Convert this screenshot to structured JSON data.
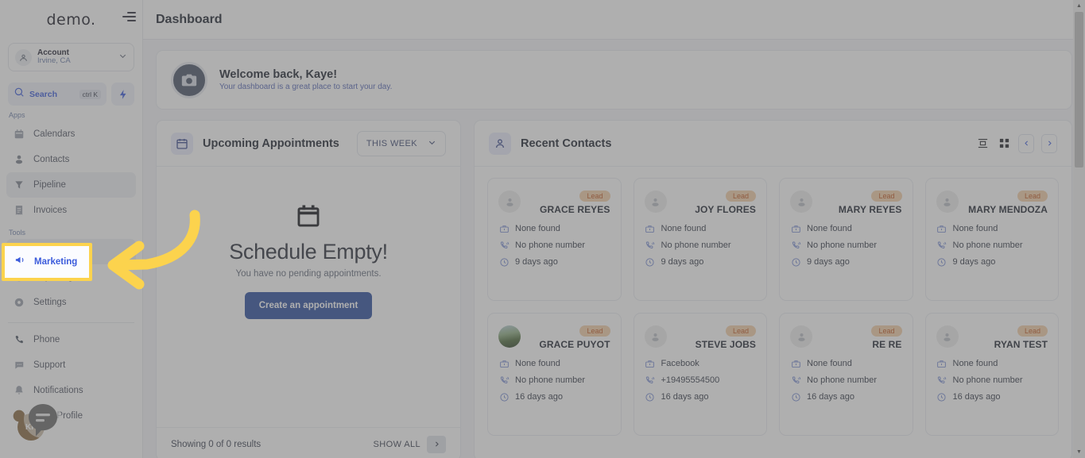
{
  "sidebar": {
    "brand": "demo.",
    "collapse_icon": "collapse-sidebar-icon",
    "account": {
      "name": "Account",
      "location": "Irvine, CA",
      "avatar_icon": "user-circle-icon",
      "chevron_icon": "chevron-down-icon"
    },
    "search": {
      "label": "Search",
      "shortcut": "ctrl K",
      "icon": "search-icon",
      "bolt_icon": "lightning-bolt-icon"
    },
    "groups": [
      {
        "label": "Apps",
        "items": [
          {
            "label": "Calendars",
            "icon": "calendar-icon",
            "active": false
          },
          {
            "label": "Contacts",
            "icon": "contacts-icon",
            "active": false
          },
          {
            "label": "Pipeline",
            "icon": "pipeline-icon",
            "active": true
          },
          {
            "label": "Invoices",
            "icon": "invoice-icon",
            "active": false
          }
        ]
      },
      {
        "label": "Tools",
        "items": [
          {
            "label": "Marketing",
            "icon": "megaphone-icon",
            "active": true
          },
          {
            "label": "Reporting",
            "icon": "reporting-icon",
            "active": false
          },
          {
            "label": "Settings",
            "icon": "settings-icon",
            "active": false
          }
        ]
      }
    ],
    "footer_items": [
      {
        "label": "Phone",
        "icon": "phone-icon"
      },
      {
        "label": "Support",
        "icon": "support-chat-icon"
      },
      {
        "label": "Notifications",
        "icon": "bell-icon"
      },
      {
        "label": "Kaye Profile",
        "icon": "avatar-icon"
      }
    ],
    "profile_initials": "KP"
  },
  "topbar": {
    "title": "Dashboard"
  },
  "welcome": {
    "title": "Welcome back, Kaye!",
    "subtitle": "Your dashboard is a great place to start your day.",
    "avatar_icon": "camera-icon"
  },
  "appointments": {
    "title": "Upcoming Appointments",
    "icon": "calendar-icon",
    "range_label": "THIS WEEK",
    "range_chevron": "chevron-down-icon",
    "empty_icon": "calendar-empty-icon",
    "empty_title": "Schedule Empty!",
    "empty_subtitle": "You have no pending appointments.",
    "cta_label": "Create an appointment",
    "footer_results": "Showing 0 of 0 results",
    "footer_show_all": "SHOW ALL",
    "footer_next_icon": "chevron-right-icon"
  },
  "contacts": {
    "title": "Recent Contacts",
    "icon": "user-icon",
    "tools": [
      {
        "name": "list-view-icon"
      },
      {
        "name": "grid-view-icon"
      }
    ],
    "pager": {
      "prev_icon": "chevron-left-icon",
      "next_icon": "chevron-right-icon"
    },
    "cards": [
      {
        "badge": "Lead",
        "name": "GRACE REYES",
        "company": "None found",
        "phone": "No phone number",
        "time": "9 days ago",
        "avatar": "placeholder"
      },
      {
        "badge": "Lead",
        "name": "JOY FLORES",
        "company": "None found",
        "phone": "No phone number",
        "time": "9 days ago",
        "avatar": "placeholder"
      },
      {
        "badge": "Lead",
        "name": "MARY REYES",
        "company": "None found",
        "phone": "No phone number",
        "time": "9 days ago",
        "avatar": "placeholder"
      },
      {
        "badge": "Lead",
        "name": "MARY MENDOZA",
        "company": "None found",
        "phone": "No phone number",
        "time": "9 days ago",
        "avatar": "placeholder"
      },
      {
        "badge": "Lead",
        "name": "GRACE PUYOT",
        "company": "None found",
        "phone": "No phone number",
        "time": "16 days ago",
        "avatar": "photo"
      },
      {
        "badge": "Lead",
        "name": "STEVE JOBS",
        "company": "Facebook",
        "phone": "+19495554500",
        "time": "16 days ago",
        "avatar": "placeholder"
      },
      {
        "badge": "Lead",
        "name": "RE RE",
        "company": "None found",
        "phone": "No phone number",
        "time": "16 days ago",
        "avatar": "placeholder"
      },
      {
        "badge": "Lead",
        "name": "RYAN TEST",
        "company": "None found",
        "phone": "No phone number",
        "time": "16 days ago",
        "avatar": "placeholder"
      }
    ],
    "row_icons": {
      "company": "briefcase-icon",
      "phone": "phone-ring-icon",
      "time": "clock-icon"
    }
  },
  "scrollbar": {
    "up_icon": "scroll-up-arrow",
    "down_icon": "scroll-down-arrow"
  },
  "annotation": {
    "target_label": "Marketing",
    "highlight_color": "#fcd34d",
    "arrow_color": "#fcd34d"
  },
  "chat_widget": {
    "icon": "chat-bubble-icon"
  }
}
